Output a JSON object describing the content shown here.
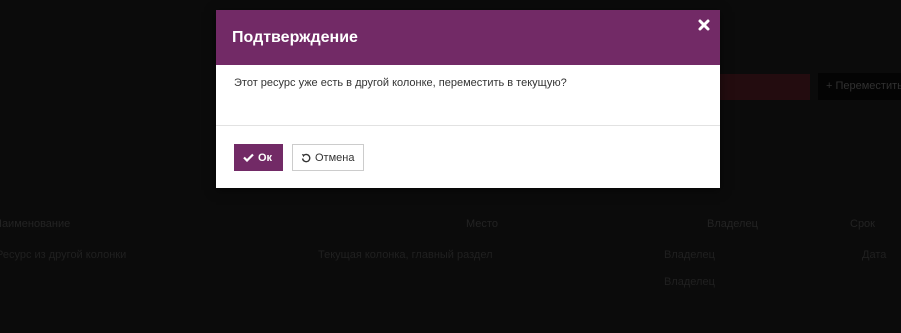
{
  "dialog": {
    "title": "Подтверждение",
    "message": "Этот ресурс уже есть в другой колонке, переместить в текущую?",
    "ok_label": "Ок",
    "cancel_label": "Отмена",
    "accent_color": "#722a66"
  },
  "background": {
    "button_label": "+ Переместить",
    "table_headers": [
      "Наименование",
      "Место",
      "Владелец",
      "Срок"
    ],
    "rows": [
      {
        "name": "Ресурс из другой колонки",
        "place": "Текущая колонка, главный раздел",
        "owner": "Владелец",
        "date": "Дата"
      },
      {
        "name": "",
        "place": "",
        "owner": "Владелец",
        "date": ""
      }
    ]
  }
}
